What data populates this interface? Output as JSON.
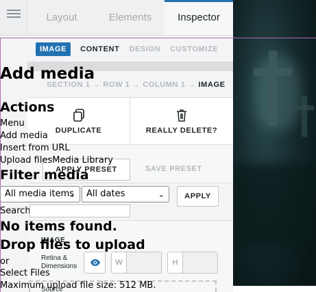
{
  "builder": {
    "tabs": [
      {
        "label": "Layout"
      },
      {
        "label": "Elements"
      },
      {
        "label": "Inspector"
      }
    ],
    "subtabs": {
      "badge": "IMAGE",
      "content": "CONTENT",
      "design": "DESIGN",
      "customize": "CUSTOMIZE"
    },
    "breadcrumb": {
      "trail": "SECTION 1 → ROW 1 → COLUMN 1 →",
      "current": "IMAGE"
    },
    "actions": {
      "duplicate": "DUPLICATE",
      "delete": "REALLY DELETE?"
    },
    "presets": {
      "apply": "APPLY PRESET",
      "save": "SAVE PRESET"
    },
    "image_field": {
      "label": "IMAGE",
      "retina": "Retina & Dimensions",
      "width_prefix": "W",
      "height_prefix": "H",
      "source_label": "Source"
    }
  },
  "media_frame": {
    "title": "Add media",
    "actions_heading": "Actions",
    "menu_label": "Menu",
    "menu_items": [
      "Add media",
      "Insert from URL",
      "Upload files",
      "Media Library"
    ],
    "filter_heading": "Filter media",
    "type_filter": "All media items",
    "date_filter": "All dates",
    "apply_label": "APPLY",
    "search_label": "Search",
    "search_value": "",
    "no_items": "No items found.",
    "drop_heading": "Drop files to upload",
    "or_text": "or",
    "select_files": "Select Files",
    "max_upload": "Maximum upload file size: 512 MB."
  },
  "colors": {
    "accent": "#2271b1",
    "frame_border": "#b06ab3"
  }
}
